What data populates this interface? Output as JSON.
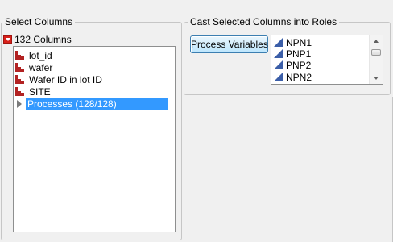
{
  "select_columns": {
    "title": "Select Columns",
    "count_label": "132 Columns",
    "items": [
      {
        "label": "lot_id",
        "icon": "nominal-bar-icon"
      },
      {
        "label": "wafer",
        "icon": "nominal-bar-icon"
      },
      {
        "label": "Wafer ID in lot ID",
        "icon": "nominal-bar-icon"
      },
      {
        "label": "SITE",
        "icon": "nominal-bar-icon"
      },
      {
        "label": "Processes (128/128)",
        "icon": "expand-triangle-icon",
        "selected": true
      }
    ]
  },
  "cast_roles": {
    "title": "Cast Selected Columns into Roles",
    "button_label": "Process Variables",
    "role_items": [
      {
        "label": "NPN1",
        "icon": "continuous-triangle-icon"
      },
      {
        "label": "PNP1",
        "icon": "continuous-triangle-icon"
      },
      {
        "label": "PNP2",
        "icon": "continuous-triangle-icon"
      },
      {
        "label": "NPN2",
        "icon": "continuous-triangle-icon"
      }
    ]
  },
  "colors": {
    "selection": "#3399ff",
    "nominal_icon": "#b22222",
    "continuous_icon": "#3b5ea8",
    "disclosure": "#d8201a"
  }
}
